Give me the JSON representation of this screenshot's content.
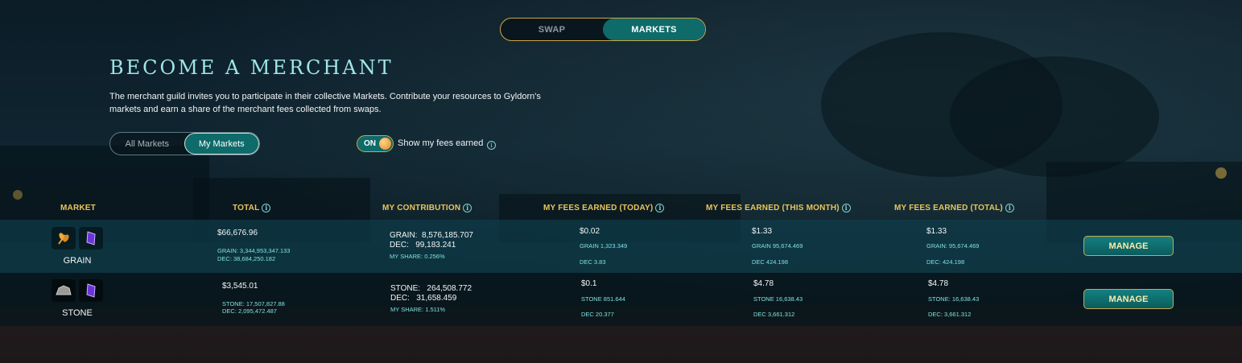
{
  "top_tabs": [
    {
      "label": "SWAP",
      "active": false
    },
    {
      "label": "MARKETS",
      "active": true
    }
  ],
  "title": "BECOME A MERCHANT",
  "description_line1": "The merchant guild invites you to participate in their collective Markets. Contribute your resources to Gyldorn's",
  "description_line2": "markets and earn a share of the merchant fees collected from swaps.",
  "market_filter": [
    {
      "label": "All Markets",
      "active": false
    },
    {
      "label": "My Markets",
      "active": true
    }
  ],
  "fee_toggle": {
    "state": "ON",
    "label": "Show my fees earned"
  },
  "columns": {
    "market": "MARKET",
    "total": "TOTAL",
    "contribution": "MY CONTRIBUTION",
    "fees_today": "MY FEES EARNED (TODAY)",
    "fees_month": "MY FEES EARNED (THIS MONTH)",
    "fees_total": "MY FEES EARNED (TOTAL)"
  },
  "rows": [
    {
      "name": "GRAIN",
      "icons": [
        "grain-icon",
        "dec-crystal-icon"
      ],
      "total": "$66,676.96",
      "total_res": "GRAIN: 3,344,953,347.133",
      "total_dec": "DEC: 38,684,250.182",
      "contrib_res_label": "GRAIN:",
      "contrib_res_value": "8,576,185.707",
      "contrib_dec_label": "DEC:",
      "contrib_dec_value": "99,183.241",
      "share": "MY SHARE: 0.256%",
      "today": "$0.02",
      "today_res": "GRAIN 1,323.349",
      "today_dec": "DEC 3.83",
      "month": "$1.33",
      "month_res": "GRAIN 95,674.469",
      "month_dec": "DEC 424.198",
      "alltime": "$1.33",
      "alltime_res": "GRAIN: 95,674.469",
      "alltime_dec": "DEC: 424.198",
      "action": "MANAGE"
    },
    {
      "name": "STONE",
      "icons": [
        "stone-icon",
        "dec-crystal-icon"
      ],
      "total": "$3,545.01",
      "total_res": "STONE: 17,507,827.88",
      "total_dec": "DEC: 2,095,472.487",
      "contrib_res_label": "STONE:",
      "contrib_res_value": "264,508.772",
      "contrib_dec_label": "DEC:",
      "contrib_dec_value": "31,658.459",
      "share": "MY SHARE: 1.511%",
      "today": "$0.1",
      "today_res": "STONE 851.644",
      "today_dec": "DEC 20.377",
      "month": "$4.78",
      "month_res": "STONE 16,638.43",
      "month_dec": "DEC 3,661.312",
      "alltime": "$4.78",
      "alltime_res": "STONE: 16,638.43",
      "alltime_dec": "DEC: 3,661.312",
      "action": "MANAGE"
    }
  ],
  "colors": {
    "accent_teal": "#0f6a6a",
    "gold": "#e9c55a",
    "title": "#9fe6e8",
    "sub_value": "#7fe0e0"
  }
}
